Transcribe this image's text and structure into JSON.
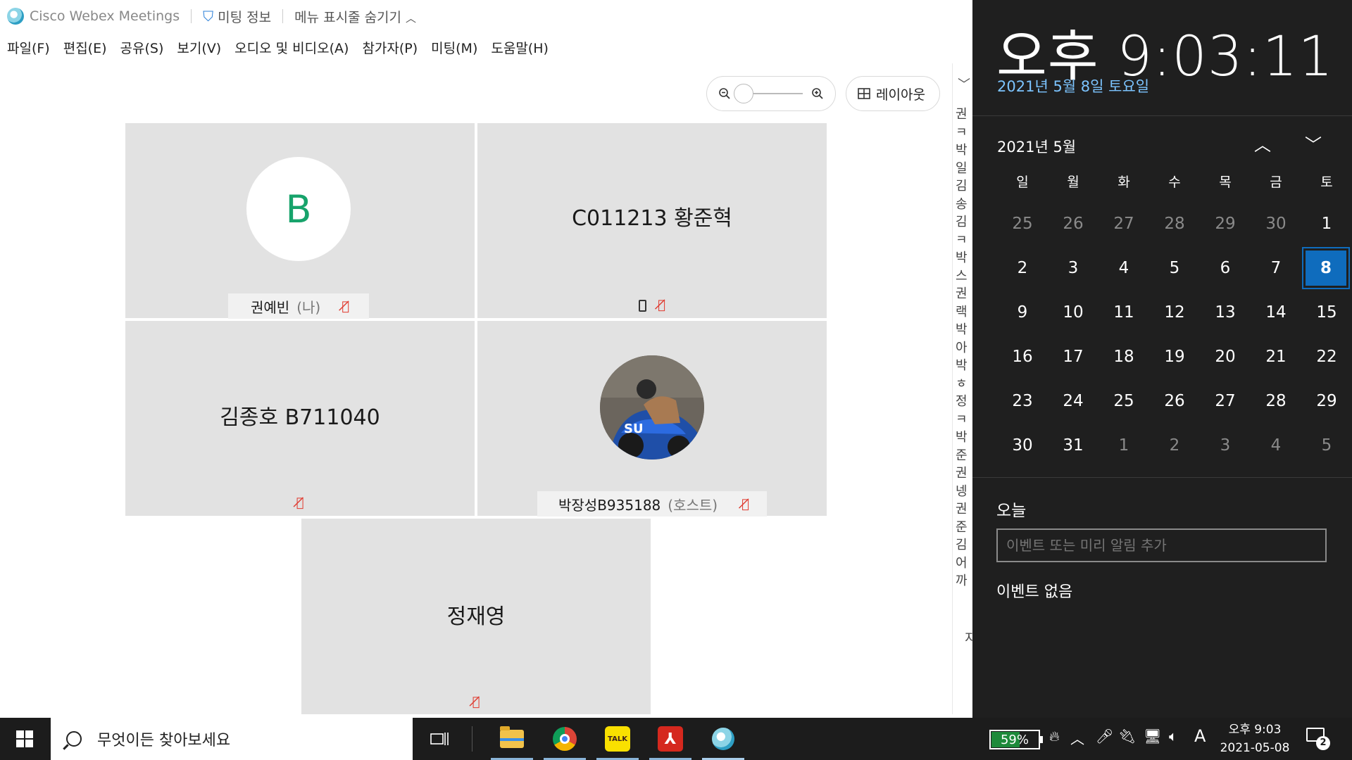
{
  "titlebar": {
    "app_name": "Cisco Webex Meetings",
    "meeting_info": "미팅 정보",
    "hide_menu": "메뉴 표시줄 숨기기"
  },
  "menubar": {
    "items": [
      "파일(F)",
      "편집(E)",
      "공유(S)",
      "보기(V)",
      "오디오 및 비디오(A)",
      "참가자(P)",
      "미팅(M)",
      "도움말(H)"
    ]
  },
  "controls": {
    "layout_label": "레이아웃"
  },
  "participants": {
    "me": {
      "initial": "B",
      "name": "권예빈",
      "tag": "(나)"
    },
    "p2": {
      "name": "C011213 황준혁"
    },
    "p3": {
      "name": "김종호 B711040"
    },
    "p4": {
      "name": "박장성B935188",
      "tag": "(호스트)"
    },
    "p5": {
      "name": "정재영"
    }
  },
  "panel_strip": [
    "권",
    "ㅋ",
    "박",
    "일",
    "김",
    "송",
    "김",
    "ㅋ",
    "박",
    "스",
    "권",
    "랙",
    "박",
    "아",
    "박",
    "ㅎ",
    "정",
    "ㅋ",
    "박",
    "준",
    "권",
    "넹",
    "권",
    "준",
    "김",
    "어",
    "까"
  ],
  "panel_bottom": "지",
  "flyout": {
    "time": "오후 9:03:11",
    "date": "2021년 5월 8일 토요일",
    "month": "2021년 5월",
    "weekdays": [
      "일",
      "월",
      "화",
      "수",
      "목",
      "금",
      "토"
    ],
    "weeks": [
      [
        "25",
        "26",
        "27",
        "28",
        "29",
        "30",
        "1"
      ],
      [
        "2",
        "3",
        "4",
        "5",
        "6",
        "7",
        "8"
      ],
      [
        "9",
        "10",
        "11",
        "12",
        "13",
        "14",
        "15"
      ],
      [
        "16",
        "17",
        "18",
        "19",
        "20",
        "21",
        "22"
      ],
      [
        "23",
        "24",
        "25",
        "26",
        "27",
        "28",
        "29"
      ],
      [
        "30",
        "31",
        "1",
        "2",
        "3",
        "4",
        "5"
      ]
    ],
    "today_section": "오늘",
    "event_placeholder": "이벤트 또는 미리 알림 추가",
    "no_events": "이벤트 없음"
  },
  "taskbar": {
    "search_placeholder": "무엇이든 찾아보세요",
    "kakao_label": "TALK",
    "battery": "59%",
    "battery_level": 0.59,
    "ime": "A",
    "clock_time": "오후 9:03",
    "clock_date": "2021-05-08",
    "notif_count": "2"
  }
}
